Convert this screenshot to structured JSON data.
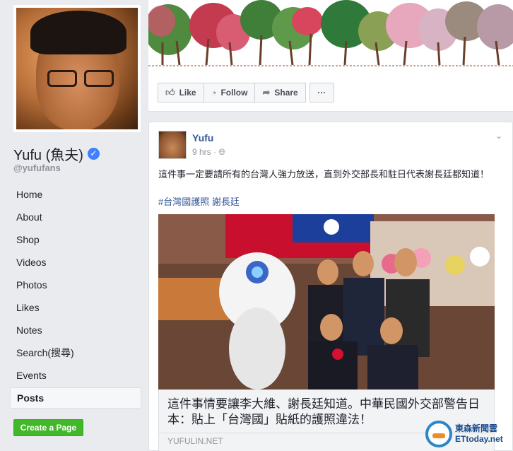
{
  "sidebar": {
    "page_name": "Yufu (魚夫)",
    "handle": "@yufufans",
    "nav": [
      "Home",
      "About",
      "Shop",
      "Videos",
      "Photos",
      "Likes",
      "Notes",
      "Search(搜尋)",
      "Events",
      "Posts"
    ],
    "active_nav": "Posts",
    "create_page": "Create a Page"
  },
  "cover": {
    "actions": {
      "like": "Like",
      "follow": "Follow",
      "share": "Share",
      "more": "···"
    }
  },
  "post": {
    "author": "Yufu",
    "time": "9 hrs ·",
    "text": "這件事一定要請所有的台灣人強力放送，直到外交部長和駐日代表謝長廷都知道！",
    "hashtags": "#台灣國護照 謝長廷",
    "link_title": "這件事情要讓李大維、謝長廷知道。中華民國外交部警告日本：貼上「台灣國」貼紙的護照違法！",
    "link_domain": "YUFULIN.NET"
  },
  "watermark": {
    "line1": "東森新聞雲",
    "line2": "ETtoday.net"
  },
  "colors": {
    "link": "#365899",
    "verified": "#4080ff",
    "create_btn": "#42b72a"
  }
}
